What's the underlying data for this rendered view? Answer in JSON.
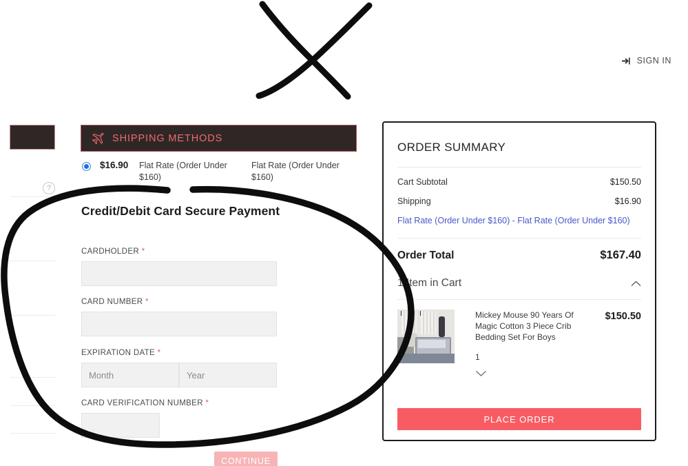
{
  "header": {
    "signin_label": "SIGN IN",
    "signin_icon": "sign-in-arrow-icon"
  },
  "shipping": {
    "section_title": "SHIPPING METHODS",
    "section_icon": "airplane-icon",
    "option": {
      "price": "$16.90",
      "method_name": "Flat Rate (Order Under $160)",
      "carrier_name": "Flat Rate (Order Under $160)",
      "selected": true
    }
  },
  "payment": {
    "title": "Credit/Debit Card Secure Payment",
    "fields": {
      "cardholder": {
        "label": "CARDHOLDER",
        "required_mark": "*",
        "value": "",
        "placeholder": ""
      },
      "card_number": {
        "label": "CARD NUMBER",
        "required_mark": "*",
        "value": "",
        "placeholder": ""
      },
      "expiration": {
        "label": "EXPIRATION DATE",
        "required_mark": "*",
        "month_placeholder": "Month",
        "month_value": "",
        "year_placeholder": "Year",
        "year_value": ""
      },
      "cvn": {
        "label": "CARD VERIFICATION NUMBER",
        "required_mark": "*",
        "value": "",
        "placeholder": ""
      }
    },
    "continue_label": "CONTINUE"
  },
  "order_summary": {
    "title": "ORDER SUMMARY",
    "lines": [
      {
        "label": "Cart Subtotal",
        "value": "$150.50"
      },
      {
        "label": "Shipping",
        "value": "$16.90"
      }
    ],
    "shipping_description": "Flat Rate (Order Under $160) - Flat Rate (Order Under $160)",
    "total_label": "Order Total",
    "total_value": "$167.40",
    "cart_toggle_label": "1 Item in Cart",
    "cart_toggle_icon": "chevron-up-icon",
    "item": {
      "name": "Mickey Mouse 90 Years Of Magic Cotton 3 Piece Crib Bedding Set For Boys",
      "qty": "1",
      "price": "$150.50",
      "thumbnail_icon": "product-thumbnail",
      "details_icon": "chevron-down-icon"
    },
    "place_order_label": "PLACE ORDER"
  },
  "left_panel": {
    "help_icon_label": "?"
  },
  "annotations": {
    "cross_mark": "hand-drawn-x",
    "circle_mark": "hand-drawn-oval"
  },
  "colors": {
    "accent_red": "#f85c63",
    "header_dark": "#2f2726",
    "header_text": "#ef6a6f",
    "link_blue": "#4a57c9",
    "radio_blue": "#1a73e8",
    "disabled_pink": "#f7b4b7"
  }
}
